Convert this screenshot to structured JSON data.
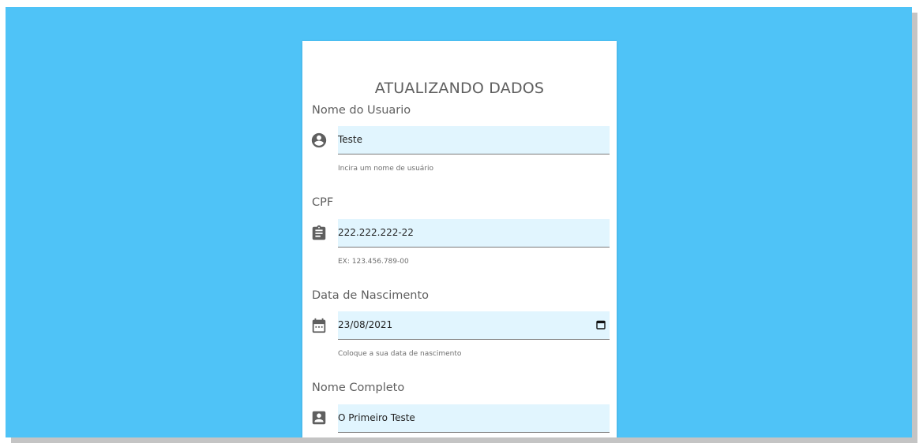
{
  "form": {
    "title": "ATUALIZANDO DADOS",
    "fields": [
      {
        "label": "Nome do Usuario",
        "value": "Teste",
        "helper": "Incira um nome de usuário",
        "icon": "account-circle-icon"
      },
      {
        "label": "CPF",
        "value": "222.222.222-22",
        "helper": "EX: 123.456.789-00",
        "icon": "clipboard-text-icon"
      },
      {
        "label": "Data de Nascimento",
        "value": "23/08/2021",
        "helper": "Coloque a sua data de nascimento",
        "icon": "calendar-icon"
      },
      {
        "label": "Nome Completo",
        "value": "O Primeiro Teste",
        "helper": "",
        "icon": "account-box-icon"
      }
    ]
  },
  "colors": {
    "background": "#4fc3f7",
    "input_fill": "#e1f5fe",
    "card": "#ffffff",
    "label_text": "#5f5f5f"
  }
}
